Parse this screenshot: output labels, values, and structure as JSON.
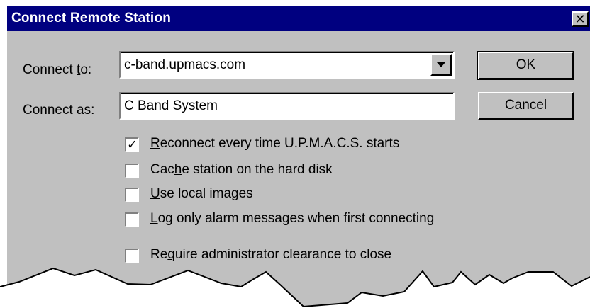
{
  "window": {
    "title": "Connect Remote Station",
    "close_glyph": "✕"
  },
  "form": {
    "connect_to": {
      "label_pre": "Connect ",
      "label_u": "t",
      "label_post": "o:",
      "value": "c-band.upmacs.com"
    },
    "connect_as": {
      "label_u": "C",
      "label_post": "onnect as:",
      "value": "C Band System"
    }
  },
  "buttons": {
    "ok": "OK",
    "cancel": "Cancel"
  },
  "options": [
    {
      "checked": true,
      "pre": "",
      "u": "R",
      "post": "econnect every time U.P.M.A.C.S. starts"
    },
    {
      "checked": false,
      "pre": "Cac",
      "u": "h",
      "post": "e station on the hard disk"
    },
    {
      "checked": false,
      "pre": "",
      "u": "U",
      "post": "se local images"
    },
    {
      "checked": false,
      "pre": "",
      "u": "L",
      "post": "og only alarm messages when first connecting"
    },
    {
      "checked": false,
      "pre": "Re",
      "u": "q",
      "post": "uire administrator clearance to close"
    }
  ],
  "checkmark_glyph": "✓"
}
